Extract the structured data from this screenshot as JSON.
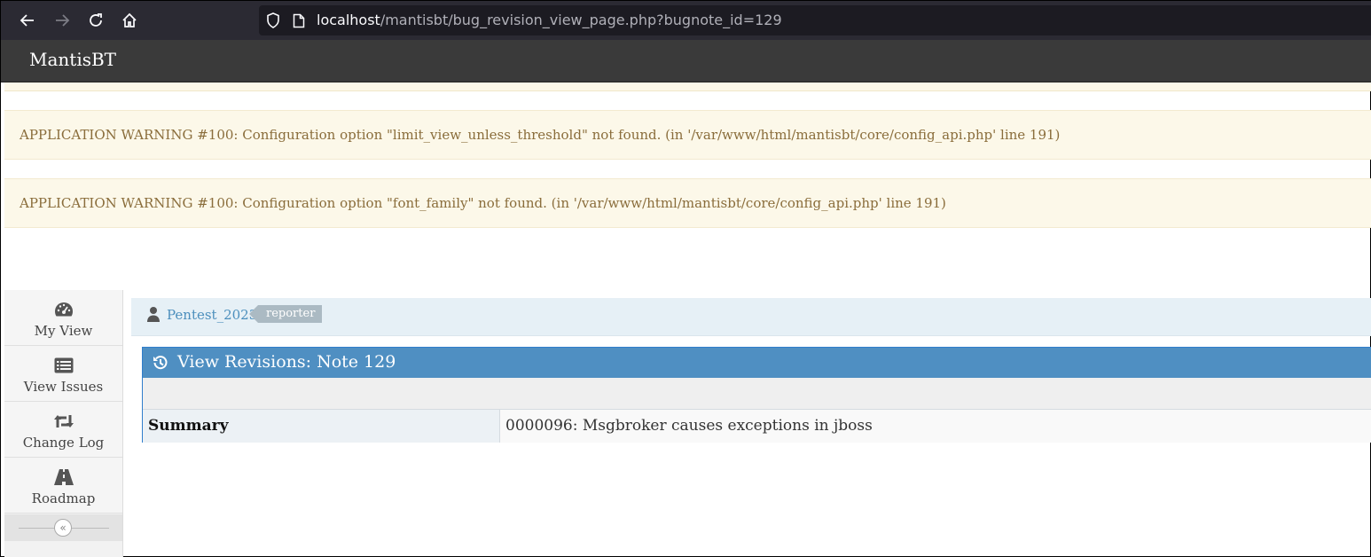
{
  "browser": {
    "url_host": "localhost",
    "url_path": "/mantisbt/bug_revision_view_page.php?bugnote_id=129"
  },
  "app": {
    "brand": "MantisBT"
  },
  "warnings": [
    "APPLICATION WARNING #100: Configuration option \"limit_view_unless_threshold\" not found. (in '/var/www/html/mantisbt/core/config_api.php' line 191)",
    "APPLICATION WARNING #100: Configuration option \"font_family\" not found. (in '/var/www/html/mantisbt/core/config_api.php' line 191)"
  ],
  "sidebar": {
    "items": [
      {
        "label": "My View",
        "icon": "dashboard-icon"
      },
      {
        "label": "View Issues",
        "icon": "list-icon"
      },
      {
        "label": "Change Log",
        "icon": "retweet-icon"
      },
      {
        "label": "Roadmap",
        "icon": "road-icon"
      }
    ],
    "collapse_glyph": "«"
  },
  "user": {
    "name": "Pentest_2023",
    "role": "reporter"
  },
  "revisions": {
    "title": "View Revisions: Note 129",
    "summary_label": "Summary",
    "summary_value": "0000096: Msgbroker causes exceptions in jboss"
  },
  "colors": {
    "widget_header": "#4f8fc2",
    "warning_bg": "#fcf8e9",
    "warning_text": "#8a6d3b",
    "navbar": "#3a3a3a"
  }
}
